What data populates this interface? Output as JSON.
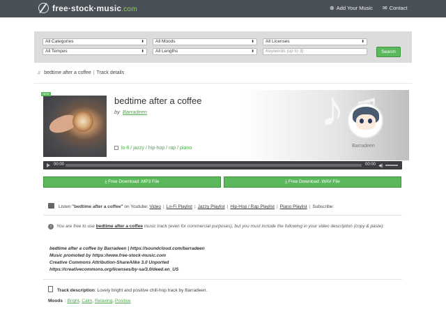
{
  "header": {
    "logo_text": "free·stock·music",
    "logo_domain": ".com",
    "nav": {
      "add_music": "Add Your Music",
      "contact": "Contact"
    }
  },
  "filters": {
    "categories": "All Categories",
    "moods": "All Moods",
    "licenses": "All Licenses",
    "tempos": "All Tempos",
    "lengths": "All Lengths",
    "keywords_placeholder": "Keywords (up to 3)",
    "search_label": "Search"
  },
  "breadcrumb": {
    "track": "bedtime after a coffee",
    "sep": "|",
    "current": "Track details"
  },
  "track": {
    "badge": "NEW",
    "title": "bedtime after a coffee",
    "by_label": "by",
    "artist": "Barradeen",
    "tags": "lo-fi / jazzy / hip-hop / rap / piano",
    "artist_caption": "Barradeen"
  },
  "player": {
    "current_time": "00:00",
    "duration": "00:00",
    "progress": 0
  },
  "downloads": {
    "mp3": "Free Download .MP3 File",
    "wav": "Free Download .WAV File"
  },
  "youtube": {
    "prefix": "Listen",
    "quoted_title": "\"bedtime after a coffee\"",
    "on_youtube": "on Youtube:",
    "links": [
      "Video",
      "Lo-Fi Playlist",
      "Jazzy Playlist",
      "Hip-Hop / Rap Playlist",
      "Piano Playlist"
    ],
    "subscribe": "Subscribe:"
  },
  "license": {
    "text_before": "You are free to use",
    "track_name": "bedtime after a coffee",
    "text_after": "music track (even for commercial purposes), but you must include the following in your video description (copy & paste):",
    "credits": [
      "bedtime after a coffee by Barradeen | https://soundcloud.com/barradeen",
      "Music promoted by https://www.free-stock-music.com",
      "Creative Commons Attribution-ShareAlike 3.0 Unported",
      "https://creativecommons.org/licenses/by-sa/3.0/deed.en_US"
    ]
  },
  "description": {
    "label": "Track description",
    "text": "Lovely bright and positive chill-hop track by Barradeen."
  },
  "moods": {
    "label": "Moods",
    "items": [
      "Bright",
      "Calm",
      "Relaxing",
      "Positive"
    ]
  }
}
